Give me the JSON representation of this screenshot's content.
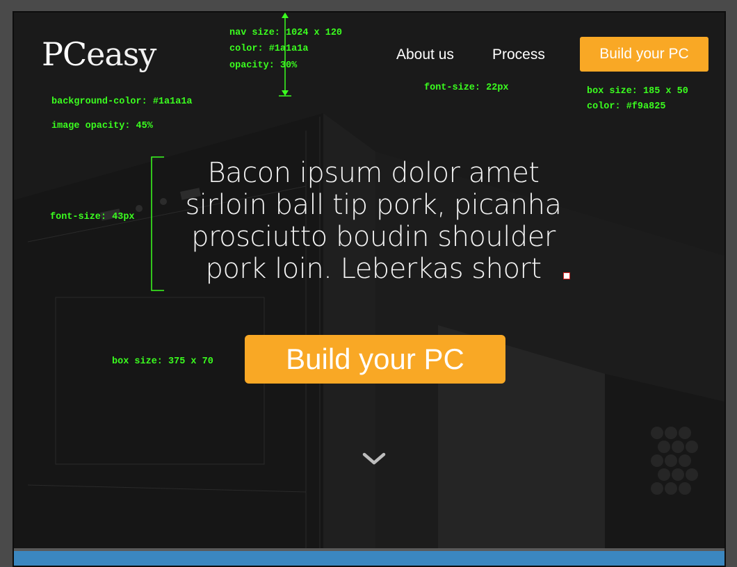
{
  "nav": {
    "logo_bold": "PC",
    "logo_light": "easy",
    "links": [
      "About us",
      "Process"
    ],
    "cta_label": "Build your PC"
  },
  "hero": {
    "title": "Bacon ipsum dolor amet sirloin ball tip pork, picanha prosciutto boudin shoulder pork loin. Leberkas short",
    "cta_label": "Build your PC"
  },
  "annotations": {
    "nav_size": "nav size: 1024 x 120",
    "nav_color": "color: #1a1a1a",
    "nav_opacity": "opacity: 30%",
    "bg_color": "background-color: #1a1a1a",
    "image_opacity": "image opacity: 45%",
    "link_font": "font-size: 22px",
    "nav_btn_size": "box size: 185 x 50",
    "nav_btn_color": "color: #f9a825",
    "title_font": "font-size: 43px",
    "hero_btn_size": "box size: 375 x 70"
  },
  "colors": {
    "accent": "#f9a825",
    "background": "#1a1a1a",
    "annotation": "#3bff1f",
    "bottom_bar": "#3b87c0"
  },
  "icons": {
    "scroll": "chevron-down-icon"
  }
}
